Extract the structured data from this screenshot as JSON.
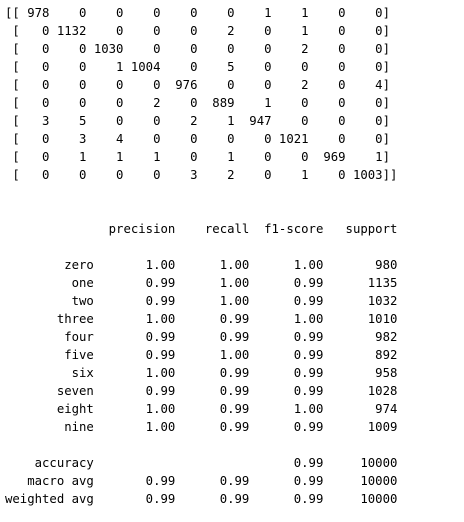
{
  "output": {
    "confusion_matrix": [
      "[[ 978    0    0    0    0    0    1    1    0    0]",
      " [   0 1132    0    0    0    2    0    1    0    0]",
      " [   0    0 1030    0    0    0    0    2    0    0]",
      " [   0    0    1 1004    0    5    0    0    0    0]",
      " [   0    0    0    0  976    0    0    2    0    4]",
      " [   0    0    0    2    0  889    1    0    0    0]",
      " [   3    5    0    0    2    1  947    0    0    0]",
      " [   0    3    4    0    0    0    0 1021    0    0]",
      " [   0    1    1    1    0    1    0    0  969    1]",
      " [   0    0    0    0    3    2    0    1    0 1003]]"
    ],
    "blank_lines": [
      "",
      ""
    ],
    "report_header": "              precision    recall  f1-score   support",
    "report_rows": [
      "        zero       1.00      1.00      1.00       980",
      "         one       0.99      1.00      0.99      1135",
      "         two       0.99      1.00      0.99      1032",
      "       three       1.00      0.99      1.00      1010",
      "        four       0.99      0.99      0.99       982",
      "        five       0.99      1.00      0.99       892",
      "         six       1.00      0.99      0.99       958",
      "       seven       0.99      0.99      0.99      1028",
      "       eight       1.00      0.99      1.00       974",
      "        nine       1.00      0.99      0.99      1009"
    ],
    "report_summary": [
      "    accuracy                           0.99     10000",
      "   macro avg       0.99      0.99      0.99     10000",
      "weighted avg       0.99      0.99      0.99     10000"
    ]
  }
}
